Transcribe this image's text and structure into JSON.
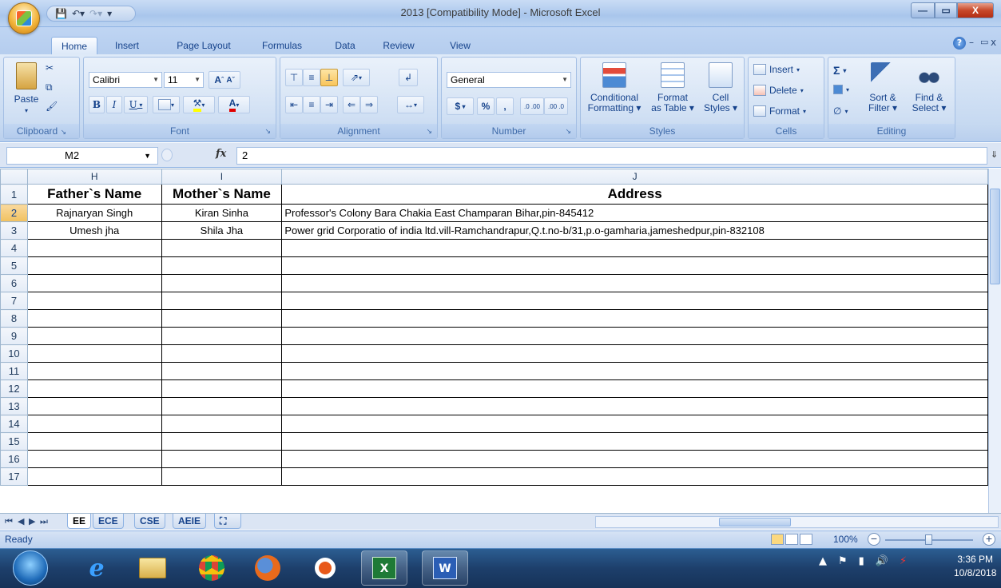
{
  "window": {
    "title": "2013  [Compatibility Mode] - Microsoft Excel"
  },
  "qat": {
    "save_icon": "floppy-save-icon",
    "undo_icon": "undo-icon",
    "redo_icon": "redo-icon"
  },
  "tabs": [
    "Home",
    "Insert",
    "Page Layout",
    "Formulas",
    "Data",
    "Review",
    "View"
  ],
  "active_tab": "Home",
  "ribbon": {
    "clipboard": {
      "paste": "Paste",
      "label": "Clipboard"
    },
    "font": {
      "name": "Calibri",
      "size": "11",
      "bold": "B",
      "italic": "I",
      "underline": "U",
      "grow": "A",
      "shrink": "A",
      "label": "Font"
    },
    "alignment": {
      "label": "Alignment"
    },
    "number": {
      "format": "General",
      "currency": "$",
      "percent": "%",
      "comma": ",",
      "inc": ".0 .00",
      "dec": ".00 .0",
      "label": "Number"
    },
    "styles": {
      "conditional_1": "Conditional",
      "conditional_2": "Formatting",
      "table_1": "Format",
      "table_2": "as Table",
      "cell_1": "Cell",
      "cell_2": "Styles",
      "label": "Styles"
    },
    "cells": {
      "insert": "Insert",
      "delete": "Delete",
      "format": "Format",
      "label": "Cells"
    },
    "editing": {
      "sort_1": "Sort &",
      "sort_2": "Filter",
      "find_1": "Find &",
      "find_2": "Select",
      "label": "Editing"
    }
  },
  "formula_bar": {
    "name_box": "M2",
    "fx": "fx",
    "value": "2"
  },
  "columns": [
    "H",
    "I",
    "J"
  ],
  "rows": [
    "1",
    "2",
    "3",
    "4",
    "5",
    "6",
    "7",
    "8",
    "9",
    "10",
    "11",
    "12",
    "13",
    "14",
    "15",
    "16",
    "17"
  ],
  "header": {
    "father": "Father`s Name",
    "mother": "Mother`s Name",
    "address": "Address"
  },
  "records": [
    {
      "father": "Rajnaryan Singh",
      "mother": "Kiran Sinha",
      "address": "Professor's Colony Bara Chakia East Champaran Bihar,pin-845412"
    },
    {
      "father": "Umesh jha",
      "mother": "Shila Jha",
      "address": "Power grid Corporatio of india ltd.vill-Ramchandrapur,Q.t.no-b/31,p.o-gamharia,jameshedpur,pin-832108"
    }
  ],
  "sheets": [
    "EE",
    "ECE",
    "CSE",
    "AEIE"
  ],
  "active_sheet": "EE",
  "status": {
    "ready": "Ready",
    "zoom": "100%"
  },
  "taskbar": {
    "apps": [
      "ie-icon",
      "explorer-icon",
      "chrome-icon",
      "firefox-icon",
      "media-player-icon",
      "excel-icon",
      "word-icon"
    ]
  },
  "clock": {
    "time": "3:36 PM",
    "date": "10/8/2018"
  }
}
